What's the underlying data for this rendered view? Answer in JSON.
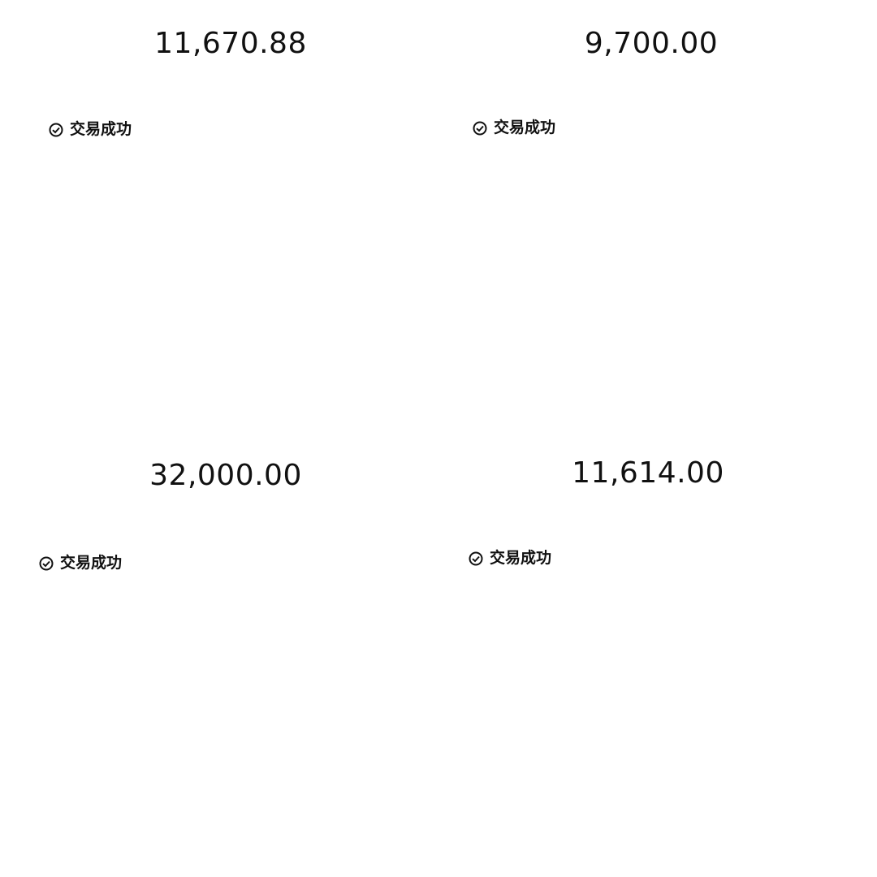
{
  "transactions": [
    {
      "amount": "11,670.88",
      "status": "交易成功",
      "status_icon": "success-check-icon"
    },
    {
      "amount": "9,700.00",
      "status": "交易成功",
      "status_icon": "success-check-icon"
    },
    {
      "amount": "32,000.00",
      "status": "交易成功",
      "status_icon": "success-check-icon"
    },
    {
      "amount": "11,614.00",
      "status": "交易成功",
      "status_icon": "success-check-icon"
    }
  ],
  "colors": {
    "text": "#111111",
    "background": "#ffffff"
  }
}
